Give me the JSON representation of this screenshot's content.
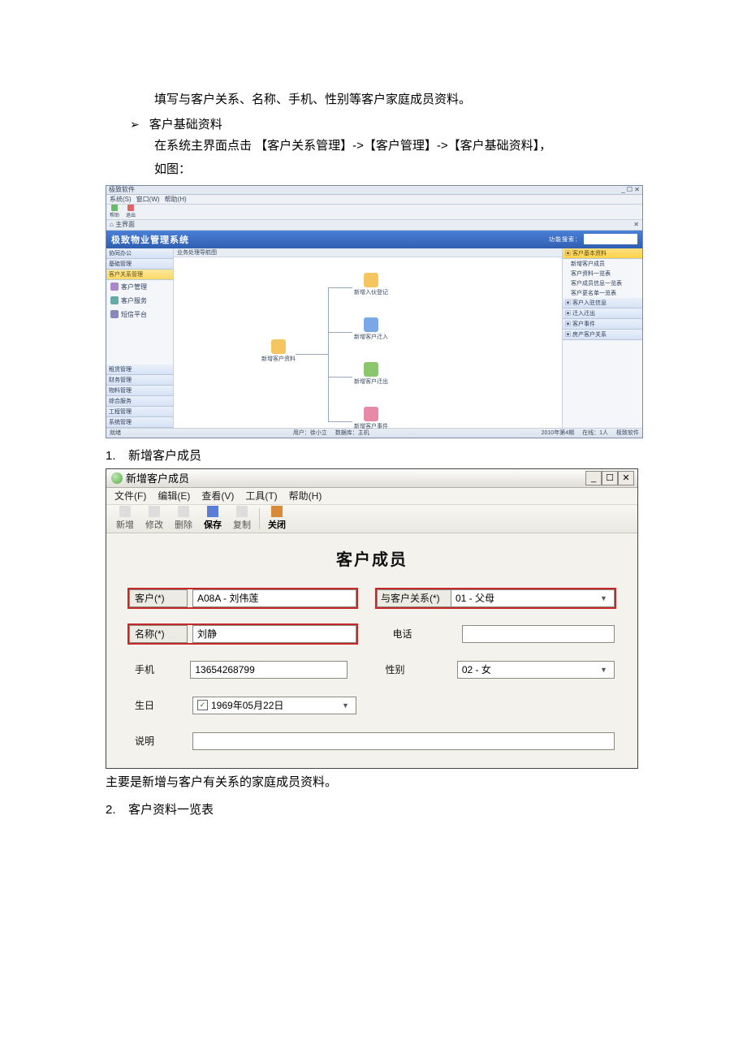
{
  "doc": {
    "intro_line": "填写与客户关系、名称、手机、性别等客户家庭成员资料。",
    "bullet_title": "客户基础资料",
    "bullet_body_a": "在系统主界面点击 【客户关系管理】->【客户管理】->【客户基础资料】，",
    "bullet_body_b": "如图：",
    "num1": "1.",
    "num1_text": "新增客户成员",
    "after_dialog": "主要是新增与客户有关系的家庭成员资料。",
    "num2": "2.",
    "num2_text": "客户资料一览表",
    "arrow": "➢"
  },
  "s1": {
    "title_left": "极致软件",
    "title_right": "_ ☐ ✕",
    "menu": [
      "系统(S)",
      "窗口(W)",
      "帮助(H)"
    ],
    "toolbar": [
      "帮助",
      "退出"
    ],
    "tab": "主界面",
    "tab_close": "✕",
    "banner_title": "极致物业管理系统",
    "search_label": "功能搜索：",
    "left_acc_top": [
      "协同办公",
      "基础管理"
    ],
    "left_acc_sel": "客户关系管理",
    "left_items": [
      "客户管理",
      "客户服务",
      "短信平台"
    ],
    "left_acc_bot": [
      "租赁管理",
      "财务管理",
      "物料管理",
      "综合服务",
      "工程管理",
      "系统管理"
    ],
    "center_head": "业务处理导航图",
    "flow_root": "新增客户资料",
    "flow_nodes": [
      "新增入伙登记",
      "新增客户迁入",
      "新增客户迁出",
      "新增客户事件"
    ],
    "right_head_sel": "客户基本资料",
    "right_lines": [
      "新增客户成员",
      "客户资料一览表",
      "客户成员信息一览表",
      "客户更名单一览表"
    ],
    "right_heads": [
      "客户入驻信息",
      "迁入迁出",
      "客户事件",
      "房产客户关系"
    ],
    "status_left": "就绪",
    "status_mid": [
      "用户：徐小立",
      "数据库：主机"
    ],
    "status_right": [
      "2010年第4期",
      "在线：1人",
      "极致软件"
    ]
  },
  "s2": {
    "title": "新增客户成员",
    "win_btns": [
      "_",
      "☐",
      "✕"
    ],
    "menu": [
      "文件(F)",
      "编辑(E)",
      "查看(V)",
      "工具(T)",
      "帮助(H)"
    ],
    "toolbar": {
      "new": "新增",
      "edit": "修改",
      "del": "删除",
      "save": "保存",
      "copy": "复制",
      "close": "关闭"
    },
    "heading": "客户成员",
    "labels": {
      "customer": "客户(*)",
      "relation": "与客户关系(*)",
      "name": "名称(*)",
      "phone": "电话",
      "mobile": "手机",
      "gender": "性别",
      "birthday": "生日",
      "remark": "说明"
    },
    "values": {
      "customer": "A08A - 刘伟莲",
      "relation": "01 - 父母",
      "name": "刘静",
      "phone": "",
      "mobile": "13654268799",
      "gender": "02 - 女",
      "birthday": "1969年05月22日",
      "birthday_check": "✓"
    }
  }
}
